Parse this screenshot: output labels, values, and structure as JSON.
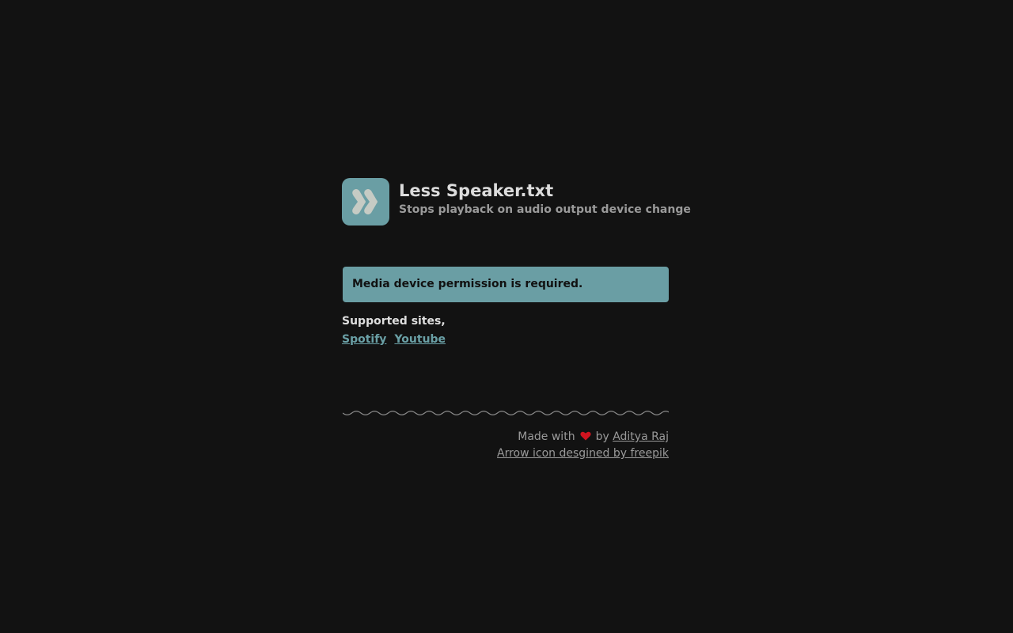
{
  "header": {
    "title": "Less Speaker.txt",
    "subtitle": "Stops playback on audio output device change",
    "logo_icon": "double-chevron-right-icon"
  },
  "alert": {
    "message": "Media device permission is required."
  },
  "sites": {
    "label": "Supported sites,",
    "links": [
      "Spotify",
      "Youtube"
    ]
  },
  "footer": {
    "made_with": "Made with",
    "by": "by",
    "author": "Aditya Raj",
    "credit": "Arrow icon desgined by freepik",
    "heart_icon": "heart-icon"
  },
  "colors": {
    "background": "#121212",
    "accent": "#6a9ea4",
    "heart": "#d0141f"
  }
}
